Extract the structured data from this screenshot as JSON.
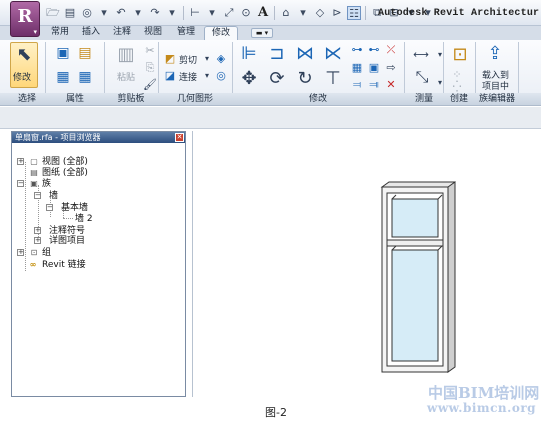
{
  "app": {
    "logo_letter": "R",
    "title": "Autodesk Revit Architectur"
  },
  "tabs": [
    {
      "label": "常用",
      "active": false
    },
    {
      "label": "插入",
      "active": false
    },
    {
      "label": "注释",
      "active": false
    },
    {
      "label": "视图",
      "active": false
    },
    {
      "label": "管理",
      "active": false
    },
    {
      "label": "修改",
      "active": true
    }
  ],
  "ribbon": {
    "modify_label": "修改",
    "paste_label": "粘贴",
    "cut_label": "剪切",
    "join_label": "连接",
    "load_label_1": "载入到",
    "load_label_2": "项目中",
    "panels": [
      "选择",
      "属性",
      "剪贴板",
      "几何图形",
      "修改",
      "测量",
      "创建",
      "族编辑器"
    ]
  },
  "browser": {
    "title": "单扇窗.rfa - 项目浏览器",
    "items": [
      {
        "label": "视图 (全部)"
      },
      {
        "label": "图纸 (全部)"
      },
      {
        "label": "族"
      },
      {
        "label": "墙"
      },
      {
        "label": "基本墙"
      },
      {
        "label": "墙 2"
      },
      {
        "label": "注释符号"
      },
      {
        "label": "详图项目"
      },
      {
        "label": "组"
      },
      {
        "label": "Revit 链接"
      }
    ]
  },
  "watermark": {
    "line1": "中国BIM培训网",
    "line2": "www.bimcn.org"
  },
  "caption": "图-2",
  "colors": {
    "app_button": "#8e3f86",
    "active_tab": "#f7f9fc",
    "browser_header": "#2d4e7e",
    "window_glass": "#d6ecf7"
  }
}
